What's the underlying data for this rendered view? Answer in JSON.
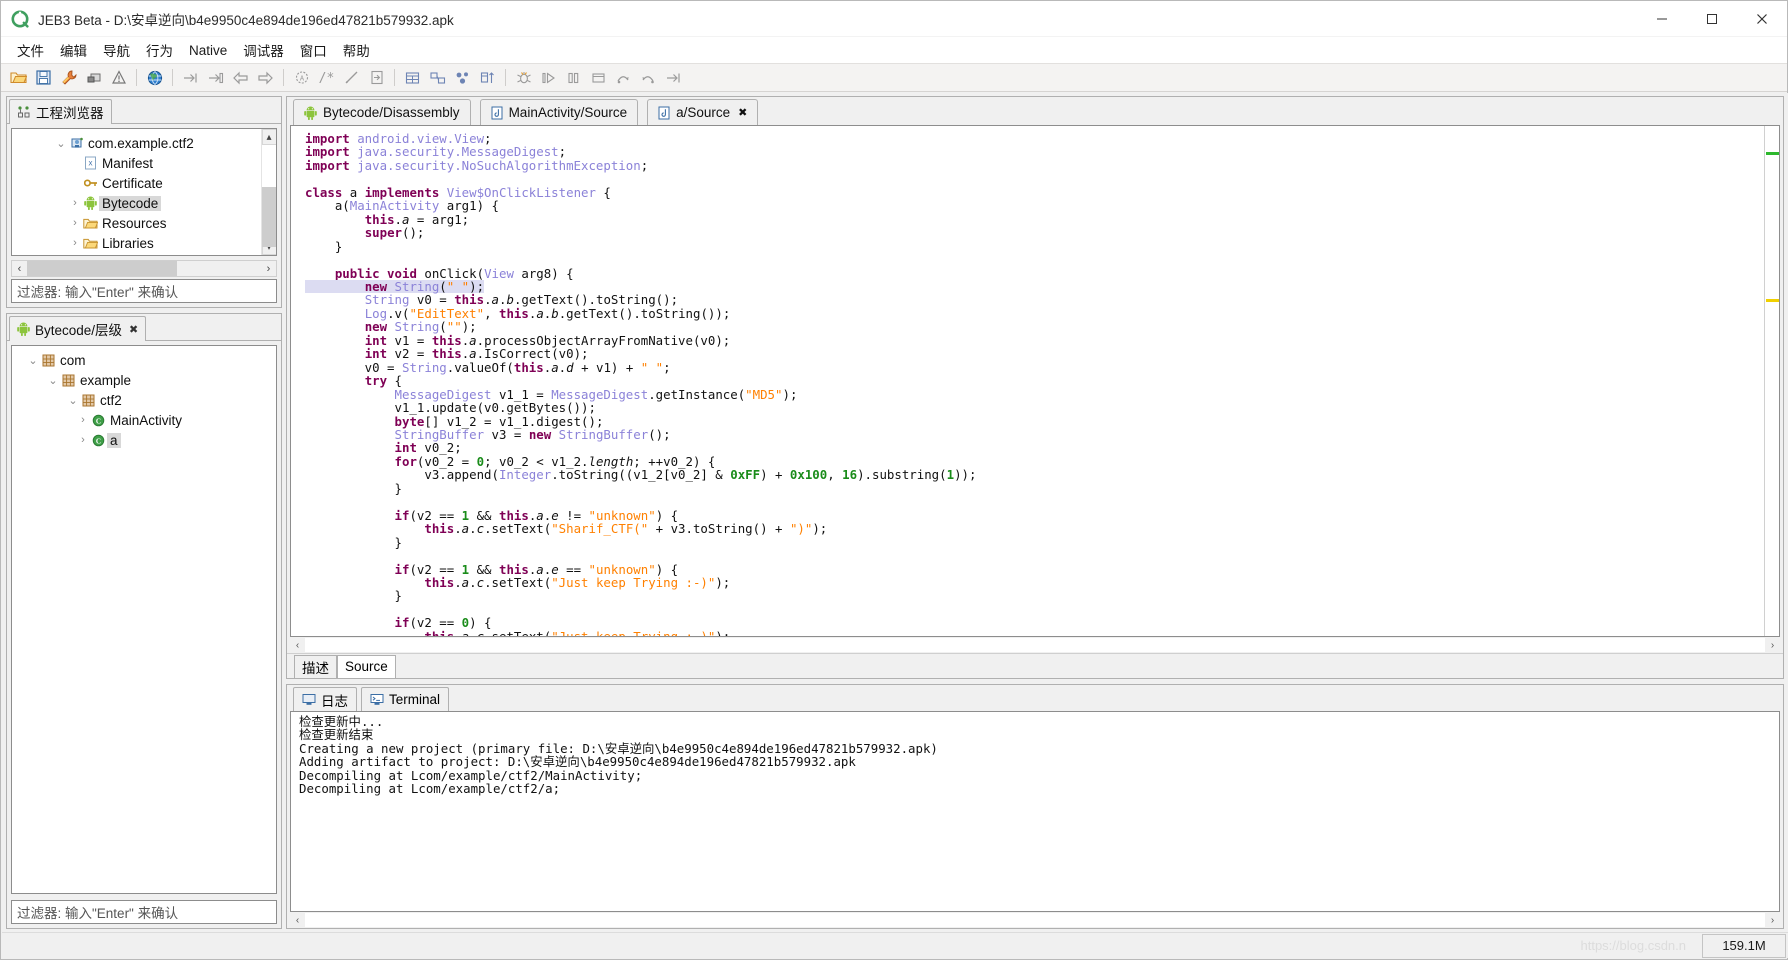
{
  "window": {
    "title": "JEB3 Beta - D:\\安卓逆向\\b4e9950c4e894de196ed47821b579932.apk",
    "logo_icon": "jeb-logo-icon",
    "minimize_glyph": "—",
    "maximize_glyph": "□",
    "close_glyph": "✕"
  },
  "menu": {
    "items": [
      {
        "label": "文件",
        "name": "menu-file"
      },
      {
        "label": "编辑",
        "name": "menu-edit"
      },
      {
        "label": "导航",
        "name": "menu-navigate"
      },
      {
        "label": "行为",
        "name": "menu-action"
      },
      {
        "label": "Native",
        "name": "menu-native"
      },
      {
        "label": "调试器",
        "name": "menu-debugger"
      },
      {
        "label": "窗口",
        "name": "menu-window"
      },
      {
        "label": "帮助",
        "name": "menu-help"
      }
    ]
  },
  "toolbar": {
    "groups": [
      [
        "open-folder-icon",
        "save-icon",
        "wrench-icon",
        "terminal-icon",
        "warning-icon"
      ],
      [
        "globe-icon"
      ],
      [
        "goto-address-icon",
        "goto-forward-icon",
        "back-arrow-icon",
        "forward-arrow-icon"
      ],
      [
        "rename-icon",
        "comment-icon",
        "edit-pencil-icon",
        "export-icon"
      ],
      [
        "table-icon",
        "graph-icon",
        "bubbles-icon",
        "sort-icon"
      ],
      [
        "debug-icon",
        "run-icon",
        "pause-icon",
        "stop-icon",
        "step-over-icon",
        "step-into-icon",
        "step-out-icon"
      ]
    ]
  },
  "project_explorer": {
    "tab_label": "工程浏览器",
    "tab_icon": "project-explorer-icon",
    "filter_placeholder": "过滤器: 输入\"Enter\" 来确认",
    "tree": [
      {
        "label": "com.example.ctf2",
        "icon": "apk-package-icon",
        "indent": 1,
        "twist": "expanded",
        "selected": false
      },
      {
        "label": "Manifest",
        "icon": "xml-file-icon",
        "indent": 2,
        "twist": "none",
        "selected": false
      },
      {
        "label": "Certificate",
        "icon": "key-icon",
        "indent": 2,
        "twist": "none",
        "selected": false
      },
      {
        "label": "Bytecode",
        "icon": "android-icon",
        "indent": 2,
        "twist": "collapsed",
        "selected": true
      },
      {
        "label": "Resources",
        "icon": "folder-icon",
        "indent": 2,
        "twist": "collapsed",
        "selected": false
      },
      {
        "label": "Libraries",
        "icon": "folder-icon",
        "indent": 2,
        "twist": "collapsed",
        "selected": false
      }
    ]
  },
  "hierarchy": {
    "tab_label": "Bytecode/层级",
    "tab_icon": "android-icon",
    "tab_close_glyph": "✖",
    "filter_placeholder": "过滤器: 输入\"Enter\" 来确认",
    "tree": [
      {
        "label": "com",
        "icon": "package-icon",
        "indent": 1,
        "twist": "expanded",
        "selected": false
      },
      {
        "label": "example",
        "icon": "package-icon",
        "indent": 2,
        "twist": "expanded",
        "selected": false
      },
      {
        "label": "ctf2",
        "icon": "package-icon",
        "indent": 3,
        "twist": "expanded",
        "selected": false
      },
      {
        "label": "MainActivity",
        "icon": "class-icon",
        "indent": 4,
        "twist": "collapsed",
        "selected": false
      },
      {
        "label": "a",
        "icon": "class-icon",
        "indent": 4,
        "twist": "collapsed",
        "selected": true
      }
    ]
  },
  "editor": {
    "tabs": [
      {
        "label": "Bytecode/Disassembly",
        "icon": "android-icon",
        "active": false,
        "closable": false
      },
      {
        "label": "MainActivity/Source",
        "icon": "java-file-icon",
        "active": false,
        "closable": false
      },
      {
        "label": "a/Source",
        "icon": "java-file-icon",
        "active": true,
        "closable": true,
        "close_glyph": "✖"
      }
    ],
    "sub_tabs": [
      {
        "label": "描述",
        "active": false
      },
      {
        "label": "Source",
        "active": true
      }
    ],
    "highlighted_line": 11,
    "overview_marks": [
      {
        "top_pct": 5,
        "color": "#2db82d"
      },
      {
        "top_pct": 34,
        "color": "#f0d000"
      }
    ],
    "code_lines": [
      [
        {
          "t": "import ",
          "c": "k"
        },
        {
          "t": "android.view.View",
          "c": "ty"
        },
        {
          "t": ";",
          "c": "id"
        }
      ],
      [
        {
          "t": "import ",
          "c": "k"
        },
        {
          "t": "java.security.MessageDigest",
          "c": "ty"
        },
        {
          "t": ";",
          "c": "id"
        }
      ],
      [
        {
          "t": "import ",
          "c": "k"
        },
        {
          "t": "java.security.NoSuchAlgorithmException",
          "c": "ty"
        },
        {
          "t": ";",
          "c": "id"
        }
      ],
      [
        {
          "t": "",
          "c": "id"
        }
      ],
      [
        {
          "t": "class ",
          "c": "k"
        },
        {
          "t": "a ",
          "c": "id"
        },
        {
          "t": "implements ",
          "c": "k"
        },
        {
          "t": "View$OnClickListener",
          "c": "ty"
        },
        {
          "t": " {",
          "c": "id"
        }
      ],
      [
        {
          "t": "    a(",
          "c": "id"
        },
        {
          "t": "MainActivity",
          "c": "ty"
        },
        {
          "t": " arg1) {",
          "c": "id"
        }
      ],
      [
        {
          "t": "        ",
          "c": "id"
        },
        {
          "t": "this",
          "c": "k"
        },
        {
          "t": ".",
          "c": "id"
        },
        {
          "t": "a",
          "c": "it"
        },
        {
          "t": " = arg1;",
          "c": "id"
        }
      ],
      [
        {
          "t": "        ",
          "c": "id"
        },
        {
          "t": "super",
          "c": "k"
        },
        {
          "t": "();",
          "c": "id"
        }
      ],
      [
        {
          "t": "    }",
          "c": "id"
        }
      ],
      [
        {
          "t": "",
          "c": "id"
        }
      ],
      [
        {
          "t": "    ",
          "c": "id"
        },
        {
          "t": "public void ",
          "c": "k"
        },
        {
          "t": "onClick(",
          "c": "id"
        },
        {
          "t": "View",
          "c": "ty"
        },
        {
          "t": " arg8) {",
          "c": "id"
        }
      ],
      [
        {
          "t": "        ",
          "c": "id"
        },
        {
          "t": "new ",
          "c": "k"
        },
        {
          "t": "String",
          "c": "ty"
        },
        {
          "t": "(",
          "c": "id"
        },
        {
          "t": "\" \"",
          "c": "st"
        },
        {
          "t": ");",
          "c": "id"
        }
      ],
      [
        {
          "t": "        ",
          "c": "id"
        },
        {
          "t": "String",
          "c": "ty"
        },
        {
          "t": " v0 = ",
          "c": "id"
        },
        {
          "t": "this",
          "c": "k"
        },
        {
          "t": ".",
          "c": "id"
        },
        {
          "t": "a",
          "c": "it"
        },
        {
          "t": ".",
          "c": "id"
        },
        {
          "t": "b",
          "c": "it"
        },
        {
          "t": ".getText().toString();",
          "c": "id"
        }
      ],
      [
        {
          "t": "        ",
          "c": "id"
        },
        {
          "t": "Log",
          "c": "ty"
        },
        {
          "t": ".v(",
          "c": "id"
        },
        {
          "t": "\"EditText\"",
          "c": "st"
        },
        {
          "t": ", ",
          "c": "id"
        },
        {
          "t": "this",
          "c": "k"
        },
        {
          "t": ".",
          "c": "id"
        },
        {
          "t": "a",
          "c": "it"
        },
        {
          "t": ".",
          "c": "id"
        },
        {
          "t": "b",
          "c": "it"
        },
        {
          "t": ".getText().toString());",
          "c": "id"
        }
      ],
      [
        {
          "t": "        ",
          "c": "id"
        },
        {
          "t": "new ",
          "c": "k"
        },
        {
          "t": "String",
          "c": "ty"
        },
        {
          "t": "(",
          "c": "id"
        },
        {
          "t": "\"\"",
          "c": "st"
        },
        {
          "t": ");",
          "c": "id"
        }
      ],
      [
        {
          "t": "        ",
          "c": "id"
        },
        {
          "t": "int ",
          "c": "k"
        },
        {
          "t": "v1 = ",
          "c": "id"
        },
        {
          "t": "this",
          "c": "k"
        },
        {
          "t": ".",
          "c": "id"
        },
        {
          "t": "a",
          "c": "it"
        },
        {
          "t": ".processObjectArrayFromNative(v0);",
          "c": "id"
        }
      ],
      [
        {
          "t": "        ",
          "c": "id"
        },
        {
          "t": "int ",
          "c": "k"
        },
        {
          "t": "v2 = ",
          "c": "id"
        },
        {
          "t": "this",
          "c": "k"
        },
        {
          "t": ".",
          "c": "id"
        },
        {
          "t": "a",
          "c": "it"
        },
        {
          "t": ".IsCorrect(v0);",
          "c": "id"
        }
      ],
      [
        {
          "t": "        v0 = ",
          "c": "id"
        },
        {
          "t": "String",
          "c": "ty"
        },
        {
          "t": ".valueOf(",
          "c": "id"
        },
        {
          "t": "this",
          "c": "k"
        },
        {
          "t": ".",
          "c": "id"
        },
        {
          "t": "a",
          "c": "it"
        },
        {
          "t": ".",
          "c": "id"
        },
        {
          "t": "d",
          "c": "it"
        },
        {
          "t": " + v1) + ",
          "c": "id"
        },
        {
          "t": "\" \"",
          "c": "st"
        },
        {
          "t": ";",
          "c": "id"
        }
      ],
      [
        {
          "t": "        ",
          "c": "id"
        },
        {
          "t": "try ",
          "c": "k"
        },
        {
          "t": "{",
          "c": "id"
        }
      ],
      [
        {
          "t": "            ",
          "c": "id"
        },
        {
          "t": "MessageDigest",
          "c": "ty"
        },
        {
          "t": " v1_1 = ",
          "c": "id"
        },
        {
          "t": "MessageDigest",
          "c": "ty"
        },
        {
          "t": ".getInstance(",
          "c": "id"
        },
        {
          "t": "\"MD5\"",
          "c": "st"
        },
        {
          "t": ");",
          "c": "id"
        }
      ],
      [
        {
          "t": "            v1_1.update(v0.getBytes());",
          "c": "id"
        }
      ],
      [
        {
          "t": "            ",
          "c": "id"
        },
        {
          "t": "byte",
          "c": "k"
        },
        {
          "t": "[] v1_2 = v1_1.digest();",
          "c": "id"
        }
      ],
      [
        {
          "t": "            ",
          "c": "id"
        },
        {
          "t": "StringBuffer",
          "c": "ty"
        },
        {
          "t": " v3 = ",
          "c": "id"
        },
        {
          "t": "new ",
          "c": "k"
        },
        {
          "t": "StringBuffer",
          "c": "ty"
        },
        {
          "t": "();",
          "c": "id"
        }
      ],
      [
        {
          "t": "            ",
          "c": "id"
        },
        {
          "t": "int ",
          "c": "k"
        },
        {
          "t": "v0_2;",
          "c": "id"
        }
      ],
      [
        {
          "t": "            ",
          "c": "id"
        },
        {
          "t": "for",
          "c": "k"
        },
        {
          "t": "(v0_2 = ",
          "c": "id"
        },
        {
          "t": "0",
          "c": "nu"
        },
        {
          "t": "; v0_2 < v1_2.",
          "c": "id"
        },
        {
          "t": "length",
          "c": "it"
        },
        {
          "t": "; ++v0_2) {",
          "c": "id"
        }
      ],
      [
        {
          "t": "                v3.append(",
          "c": "id"
        },
        {
          "t": "Integer",
          "c": "ty"
        },
        {
          "t": ".toString((v1_2[v0_2] & ",
          "c": "id"
        },
        {
          "t": "0xFF",
          "c": "nu"
        },
        {
          "t": ") + ",
          "c": "id"
        },
        {
          "t": "0x100",
          "c": "nu"
        },
        {
          "t": ", ",
          "c": "id"
        },
        {
          "t": "16",
          "c": "nu"
        },
        {
          "t": ").substring(",
          "c": "id"
        },
        {
          "t": "1",
          "c": "nu"
        },
        {
          "t": "));",
          "c": "id"
        }
      ],
      [
        {
          "t": "            }",
          "c": "id"
        }
      ],
      [
        {
          "t": "",
          "c": "id"
        }
      ],
      [
        {
          "t": "            ",
          "c": "id"
        },
        {
          "t": "if",
          "c": "k"
        },
        {
          "t": "(v2 == ",
          "c": "id"
        },
        {
          "t": "1",
          "c": "nu"
        },
        {
          "t": " && ",
          "c": "id"
        },
        {
          "t": "this",
          "c": "k"
        },
        {
          "t": ".",
          "c": "id"
        },
        {
          "t": "a",
          "c": "it"
        },
        {
          "t": ".",
          "c": "id"
        },
        {
          "t": "e",
          "c": "it"
        },
        {
          "t": " != ",
          "c": "id"
        },
        {
          "t": "\"unknown\"",
          "c": "st"
        },
        {
          "t": ") {",
          "c": "id"
        }
      ],
      [
        {
          "t": "                ",
          "c": "id"
        },
        {
          "t": "this",
          "c": "k"
        },
        {
          "t": ".",
          "c": "id"
        },
        {
          "t": "a",
          "c": "it"
        },
        {
          "t": ".",
          "c": "id"
        },
        {
          "t": "c",
          "c": "it"
        },
        {
          "t": ".setText(",
          "c": "id"
        },
        {
          "t": "\"Sharif_CTF(\"",
          "c": "st"
        },
        {
          "t": " + v3.toString() + ",
          "c": "id"
        },
        {
          "t": "\")\"",
          "c": "st"
        },
        {
          "t": ");",
          "c": "id"
        }
      ],
      [
        {
          "t": "            }",
          "c": "id"
        }
      ],
      [
        {
          "t": "",
          "c": "id"
        }
      ],
      [
        {
          "t": "            ",
          "c": "id"
        },
        {
          "t": "if",
          "c": "k"
        },
        {
          "t": "(v2 == ",
          "c": "id"
        },
        {
          "t": "1",
          "c": "nu"
        },
        {
          "t": " && ",
          "c": "id"
        },
        {
          "t": "this",
          "c": "k"
        },
        {
          "t": ".",
          "c": "id"
        },
        {
          "t": "a",
          "c": "it"
        },
        {
          "t": ".",
          "c": "id"
        },
        {
          "t": "e",
          "c": "it"
        },
        {
          "t": " == ",
          "c": "id"
        },
        {
          "t": "\"unknown\"",
          "c": "st"
        },
        {
          "t": ") {",
          "c": "id"
        }
      ],
      [
        {
          "t": "                ",
          "c": "id"
        },
        {
          "t": "this",
          "c": "k"
        },
        {
          "t": ".",
          "c": "id"
        },
        {
          "t": "a",
          "c": "it"
        },
        {
          "t": ".",
          "c": "id"
        },
        {
          "t": "c",
          "c": "it"
        },
        {
          "t": ".setText(",
          "c": "id"
        },
        {
          "t": "\"Just keep Trying :-)\"",
          "c": "st"
        },
        {
          "t": ");",
          "c": "id"
        }
      ],
      [
        {
          "t": "            }",
          "c": "id"
        }
      ],
      [
        {
          "t": "",
          "c": "id"
        }
      ],
      [
        {
          "t": "            ",
          "c": "id"
        },
        {
          "t": "if",
          "c": "k"
        },
        {
          "t": "(v2 == ",
          "c": "id"
        },
        {
          "t": "0",
          "c": "nu"
        },
        {
          "t": ") {",
          "c": "id"
        }
      ],
      [
        {
          "t": "                ",
          "c": "id"
        },
        {
          "t": "this",
          "c": "k"
        },
        {
          "t": ".",
          "c": "id"
        },
        {
          "t": "a",
          "c": "it"
        },
        {
          "t": ".",
          "c": "id"
        },
        {
          "t": "c",
          "c": "it"
        },
        {
          "t": ".setText(",
          "c": "id"
        },
        {
          "t": "\"Just keep Trying :-)\"",
          "c": "st"
        },
        {
          "t": ");",
          "c": "id"
        }
      ]
    ]
  },
  "console": {
    "tabs": [
      {
        "label": "日志",
        "icon": "log-icon",
        "active": true
      },
      {
        "label": "Terminal",
        "icon": "terminal-icon",
        "active": false
      }
    ],
    "lines": [
      "检查更新中...",
      "检查更新结束",
      "Creating a new project (primary file: D:\\安卓逆向\\b4e9950c4e894de196ed47821b579932.apk)",
      "Adding artifact to project: D:\\安卓逆向\\b4e9950c4e894de196ed47821b579932.apk",
      "Decompiling at Lcom/example/ctf2/MainActivity;",
      "Decompiling at Lcom/example/ctf2/a;"
    ]
  },
  "statusbar": {
    "watermark": "https://blog.csdn.n",
    "memory": "159.1M"
  },
  "colors": {
    "accent": "#ff8000",
    "keyword": "#7f0055",
    "type": "#8b82d8",
    "number": "#1a8c1a",
    "highlight_line": "#dcdcf2",
    "android_green": "#8cc43c"
  }
}
